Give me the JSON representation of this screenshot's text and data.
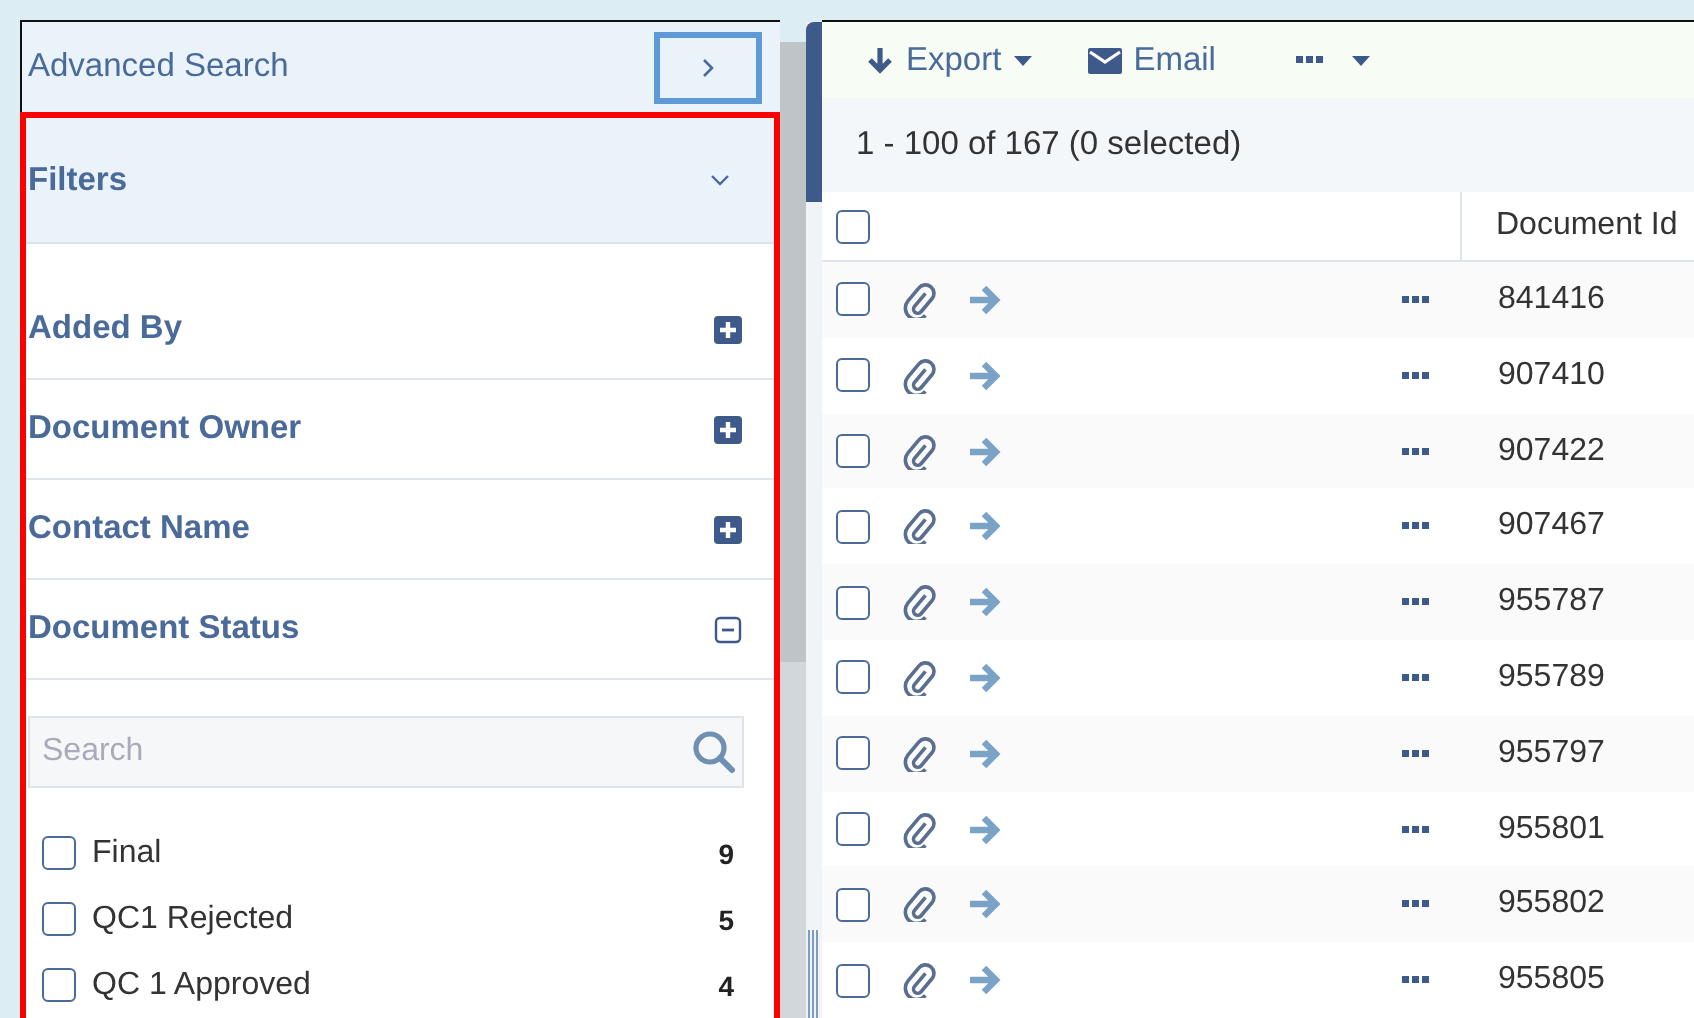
{
  "advanced_search": {
    "title": "Advanced Search"
  },
  "filters": {
    "title": "Filters",
    "expanded": true,
    "sections": [
      {
        "label": "Added By",
        "expanded": false
      },
      {
        "label": "Document Owner",
        "expanded": false
      },
      {
        "label": "Contact Name",
        "expanded": false
      },
      {
        "label": "Document Status",
        "expanded": true
      }
    ],
    "search": {
      "placeholder": "Search"
    },
    "options": [
      {
        "label": "Final",
        "count": "9",
        "checked": false
      },
      {
        "label": "QC1 Rejected",
        "count": "5",
        "checked": false
      },
      {
        "label": "QC 1 Approved",
        "count": "4",
        "checked": false
      }
    ]
  },
  "toolbar": [
    {
      "kind": "export",
      "label": "Export"
    },
    {
      "kind": "email",
      "label": "Email"
    },
    {
      "kind": "more"
    }
  ],
  "summary": "1 - 100 of 167 (0 selected)",
  "table": {
    "select_all": {
      "checked": false
    },
    "columns": [
      "Document Id"
    ],
    "rows": [
      {
        "id": "841416",
        "selected": false
      },
      {
        "id": "907410",
        "selected": false
      },
      {
        "id": "907422",
        "selected": false
      },
      {
        "id": "907467",
        "selected": false
      },
      {
        "id": "955787",
        "selected": false
      },
      {
        "id": "955789",
        "selected": false
      },
      {
        "id": "955797",
        "selected": false
      },
      {
        "id": "955801",
        "selected": false
      },
      {
        "id": "955802",
        "selected": false
      },
      {
        "id": "955805",
        "selected": false
      }
    ]
  }
}
